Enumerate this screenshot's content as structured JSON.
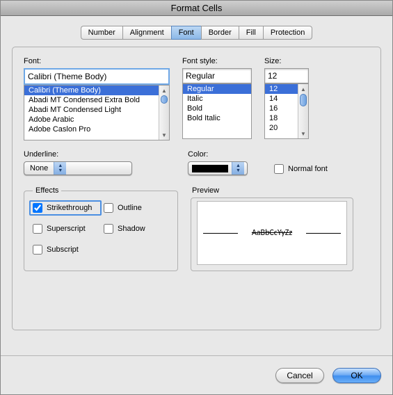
{
  "title": "Format Cells",
  "tabs": [
    "Number",
    "Alignment",
    "Font",
    "Border",
    "Fill",
    "Protection"
  ],
  "active_tab_index": 2,
  "font": {
    "label": "Font:",
    "value": "Calibri (Theme Body)",
    "options": [
      "Calibri (Theme Body)",
      "Abadi MT Condensed Extra Bold",
      "Abadi MT Condensed Light",
      "Adobe Arabic",
      "Adobe Caslon Pro"
    ],
    "selected_index": 0
  },
  "style": {
    "label": "Font style:",
    "value": "Regular",
    "options": [
      "Regular",
      "Italic",
      "Bold",
      "Bold Italic"
    ],
    "selected_index": 0
  },
  "size": {
    "label": "Size:",
    "value": "12",
    "options": [
      "12",
      "14",
      "16",
      "18",
      "20"
    ],
    "selected_index": 0
  },
  "underline": {
    "label": "Underline:",
    "value": "None"
  },
  "color": {
    "label": "Color:",
    "value": "#000000"
  },
  "normal_font": {
    "label": "Normal font",
    "checked": false
  },
  "effects": {
    "legend": "Effects",
    "strikethrough": {
      "label": "Strikethrough",
      "checked": true
    },
    "superscript": {
      "label": "Superscript",
      "checked": false
    },
    "subscript": {
      "label": "Subscript",
      "checked": false
    },
    "outline": {
      "label": "Outline",
      "checked": false
    },
    "shadow": {
      "label": "Shadow",
      "checked": false
    }
  },
  "preview": {
    "label": "Preview",
    "text": "AaBbCcYyZz"
  },
  "buttons": {
    "cancel": "Cancel",
    "ok": "OK"
  }
}
